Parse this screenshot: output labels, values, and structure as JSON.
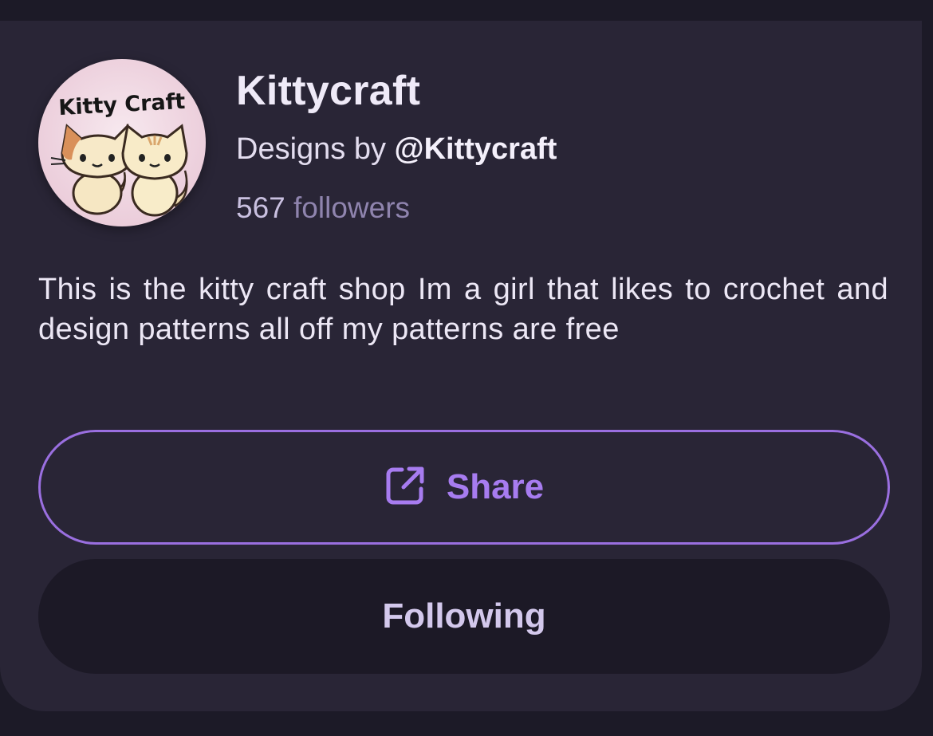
{
  "profile": {
    "avatar_text": "Kitty Craft",
    "name": "Kittycraft",
    "byline_prefix": "Designs by ",
    "handle": "@Kittycraft",
    "follower_count": "567",
    "follower_label": "followers",
    "bio": "This is the kitty craft shop Im a girl that likes to crochet and design patterns all off my patterns are free"
  },
  "actions": {
    "share_label": "Share",
    "share_icon": "external-share-icon",
    "following_label": "Following"
  },
  "colors": {
    "background": "#1c1a27",
    "card": "#292536",
    "accent": "#9a6fe0",
    "accent_text": "#a77cf0",
    "following_button": "#1c1926"
  }
}
